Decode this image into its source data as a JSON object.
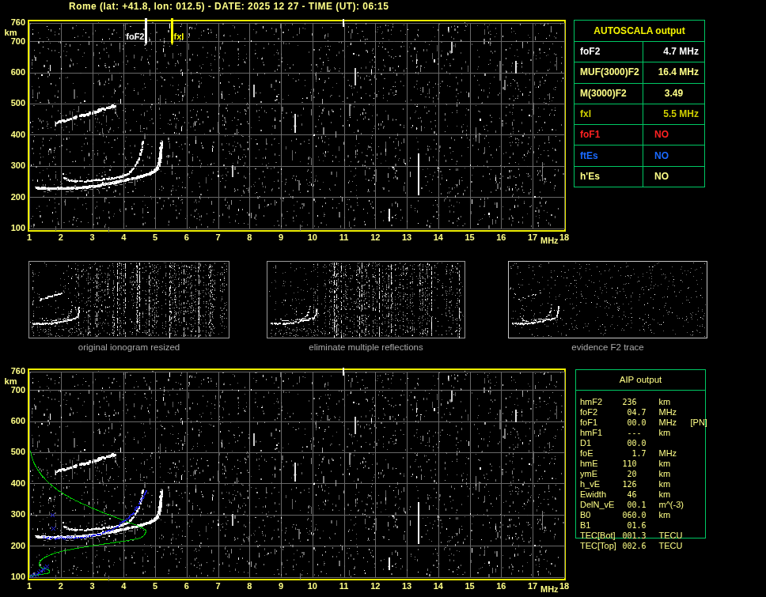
{
  "title": "Rome (lat: +41.8, lon: 012.5) - DATE: 2025 12 27 - TIME (UT): 06:15",
  "colors": {
    "background": "#000000",
    "pale_yellow_text": "#ffff87",
    "bright_yellow": "#f4f400",
    "plot_border_yellow": "#eded00",
    "grid_grey": "#686868",
    "table_border_green": "#00c864",
    "profile_green": "#00cc00",
    "fitted_blue": "#2222ee",
    "foF2_marker_white": "#ffffff",
    "fxI_marker_yellow": "#ffff00",
    "red": "#ff2222",
    "blue_text": "#1a6aff",
    "dark_yellow": "#cfcf00",
    "caption_grey": "#a9a9a9"
  },
  "autoscala_table": {
    "header": "AUTOSCALA output",
    "rows": [
      {
        "param": "foF2",
        "value": "4.7 MHz",
        "color": "#ffffff",
        "align": "right"
      },
      {
        "param": "MUF(3000)F2",
        "value": "16.4 MHz",
        "color": "#ffff87",
        "align": "right"
      },
      {
        "param": "M(3000)F2",
        "value": "3.49",
        "color": "#ffff87",
        "align": "center"
      },
      {
        "param": "fxI",
        "value": "5.5 MHz",
        "color": "#cfcf00",
        "align": "right"
      },
      {
        "param": "foF1",
        "value": "NO",
        "color": "#ff2222",
        "align": "left"
      },
      {
        "param": "ftEs",
        "value": "NO",
        "color": "#1a6aff",
        "align": "left"
      },
      {
        "param": "h'Es",
        "value": "NO",
        "color": "#ffff87",
        "align": "left"
      }
    ]
  },
  "panels": [
    {
      "caption": "original ionogram resized"
    },
    {
      "caption": "eliminate multiple reflections"
    },
    {
      "caption": "evidence F2 trace"
    }
  ],
  "aip_table": {
    "header": "AIP output",
    "rows": [
      {
        "param": "hmF2",
        "value": "236",
        "unit": "km",
        "note": ""
      },
      {
        "param": "foF2",
        "value": " 04.7",
        "unit": "MHz",
        "note": ""
      },
      {
        "param": "foF1",
        "value": " 00.0",
        "unit": "MHz",
        "note": "[PN]"
      },
      {
        "param": "hmF1",
        "value": " ---",
        "unit": "km",
        "note": ""
      },
      {
        "param": "D1",
        "value": " 00.0",
        "unit": "",
        "note": ""
      },
      {
        "param": "foE",
        "value": "  1.7",
        "unit": "MHz",
        "note": ""
      },
      {
        "param": "hmE",
        "value": "110",
        "unit": "km",
        "note": ""
      },
      {
        "param": "ymE",
        "value": " 20",
        "unit": "km",
        "note": ""
      },
      {
        "param": "h_vE",
        "value": "126",
        "unit": "km",
        "note": ""
      },
      {
        "param": "Ewidth",
        "value": " 46",
        "unit": "km",
        "note": ""
      },
      {
        "param": "DelN_vE",
        "value": " 00.1",
        "unit": "m^(-3)",
        "note": ""
      },
      {
        "param": "B0",
        "value": "060.0",
        "unit": "km",
        "note": ""
      },
      {
        "param": "B1",
        "value": " 01.6",
        "unit": "",
        "note": ""
      },
      {
        "param": "TEC[Bot]",
        "value": "001.3",
        "unit": "TECU",
        "note": ""
      },
      {
        "param": "TEC[Top]",
        "value": "002.6",
        "unit": "TECU",
        "note": ""
      }
    ]
  },
  "chart_data": {
    "type": "ionogram",
    "station": "Rome",
    "lat": "+41.8",
    "lon": "012.5",
    "date": "2025 12 27",
    "time_ut": "06:15",
    "x_axis": {
      "unit": "MHz",
      "min": 1,
      "max": 18,
      "ticks": [
        "1",
        "2",
        "3",
        "4",
        "5",
        "6",
        "7",
        "8",
        "9",
        "10",
        "11",
        "12",
        "13",
        "14",
        "15",
        "16",
        "17",
        "18"
      ]
    },
    "y_axis": {
      "unit": "km",
      "min": 100,
      "max": 760,
      "tick_labels": [
        "760",
        "km",
        "700",
        "600",
        "500",
        "400",
        "300",
        "200",
        "100"
      ]
    },
    "scaled_values": {
      "foF2_MHz": 4.7,
      "MUF3000F2_MHz": 16.4,
      "M3000F2": 3.49,
      "fxI_MHz": 5.5,
      "foF1": null,
      "ftEs": null,
      "hEs": null
    },
    "markers": [
      {
        "label": "foF2",
        "MHz": 4.71,
        "color": "#ffffff"
      },
      {
        "label": "fxI",
        "MHz": 5.52,
        "color": "#ffff00"
      }
    ],
    "traces": {
      "o_lower": {
        "th": 3,
        "pts": [
          [
            1.25,
            228
          ],
          [
            1.6,
            227
          ],
          [
            2.0,
            227
          ],
          [
            2.4,
            228
          ],
          [
            2.8,
            231
          ],
          [
            3.2,
            236
          ],
          [
            3.5,
            242
          ],
          [
            3.8,
            248
          ],
          [
            4.1,
            255
          ],
          [
            4.4,
            262
          ],
          [
            4.7,
            270
          ],
          [
            4.9,
            277
          ],
          [
            5.02,
            285
          ],
          [
            5.1,
            296
          ],
          [
            5.15,
            315
          ],
          [
            5.18,
            338
          ],
          [
            5.2,
            358
          ],
          [
            5.21,
            375
          ]
        ]
      },
      "x_upper": {
        "th": 2,
        "pts": [
          [
            2.08,
            271
          ],
          [
            2.13,
            260
          ],
          [
            2.25,
            253
          ],
          [
            2.5,
            250
          ],
          [
            2.8,
            251
          ],
          [
            3.1,
            253
          ],
          [
            3.4,
            256
          ],
          [
            3.7,
            260
          ],
          [
            3.95,
            265
          ],
          [
            4.1,
            271
          ],
          [
            4.22,
            279
          ]
        ]
      },
      "x_hook": {
        "th": 2,
        "pts": [
          [
            4.22,
            280
          ],
          [
            4.32,
            292
          ],
          [
            4.42,
            308
          ],
          [
            4.5,
            326
          ],
          [
            4.56,
            346
          ],
          [
            4.6,
            364
          ],
          [
            4.62,
            380
          ]
        ]
      },
      "hop": {
        "th": 3,
        "pts": [
          [
            1.85,
            437
          ],
          [
            2.1,
            443
          ],
          [
            2.4,
            452
          ],
          [
            2.7,
            461
          ],
          [
            3.0,
            470
          ],
          [
            3.3,
            480
          ],
          [
            3.55,
            487
          ],
          [
            3.74,
            491
          ]
        ]
      }
    },
    "profile_MHz_km": [
      [
        1.02,
        505
      ],
      [
        1.1,
        475
      ],
      [
        1.22,
        450
      ],
      [
        1.38,
        427
      ],
      [
        1.58,
        405
      ],
      [
        1.82,
        385
      ],
      [
        2.1,
        366
      ],
      [
        2.42,
        348
      ],
      [
        2.78,
        331
      ],
      [
        3.15,
        315
      ],
      [
        3.55,
        299
      ],
      [
        3.95,
        284
      ],
      [
        4.3,
        271
      ],
      [
        4.55,
        260
      ],
      [
        4.68,
        252
      ],
      [
        4.71,
        247
      ],
      [
        4.6,
        228
      ],
      [
        4.35,
        222
      ],
      [
        4.0,
        216
      ],
      [
        3.6,
        210
      ],
      [
        3.2,
        204
      ],
      [
        2.8,
        198
      ],
      [
        2.4,
        191
      ],
      [
        2.05,
        184
      ],
      [
        1.78,
        177
      ],
      [
        1.58,
        169
      ],
      [
        1.44,
        161
      ],
      [
        1.35,
        153
      ],
      [
        1.3,
        146
      ],
      [
        1.29,
        140
      ],
      [
        1.32,
        134
      ],
      [
        1.4,
        129
      ],
      [
        1.5,
        128
      ],
      [
        1.6,
        124
      ],
      [
        1.64,
        119
      ],
      [
        1.62,
        114
      ],
      [
        1.5,
        111
      ],
      [
        1.35,
        109
      ],
      [
        1.25,
        107
      ],
      [
        1.1,
        105
      ],
      [
        1.0,
        103
      ]
    ],
    "fitted_trace_MHz_km": [
      [
        1.45,
        227
      ],
      [
        1.8,
        226
      ],
      [
        2.2,
        226
      ],
      [
        2.6,
        228
      ],
      [
        2.95,
        232
      ],
      [
        3.25,
        240
      ],
      [
        3.55,
        252
      ],
      [
        3.85,
        268
      ],
      [
        4.1,
        288
      ],
      [
        4.3,
        310
      ],
      [
        4.45,
        330
      ],
      [
        4.55,
        348
      ],
      [
        4.63,
        362
      ],
      [
        4.69,
        378
      ]
    ],
    "fitted_outliers_MHz_km": [
      [
        1.72,
        300
      ],
      [
        1.76,
        255
      ],
      [
        1.05,
        104
      ],
      [
        1.15,
        106
      ],
      [
        1.22,
        109
      ],
      [
        1.3,
        113
      ],
      [
        1.35,
        118
      ],
      [
        1.42,
        124
      ],
      [
        1.5,
        130
      ],
      [
        1.55,
        135
      ]
    ],
    "noise": {
      "seed": 20251227,
      "dots": 2600,
      "streaks": 40,
      "bright_streaks": [
        {
          "MHz": 10.97,
          "km": [
            772,
            745
          ],
          "color": "#ffffff"
        },
        {
          "MHz": 13.35,
          "km": [
            340,
            205
          ],
          "color": "#ffffff"
        },
        {
          "MHz": 9.42,
          "km": [
            468,
            405
          ],
          "color": "#e8e8e8"
        },
        {
          "MHz": 11.33,
          "km": [
            615,
            558
          ],
          "color": "#d0d0d0"
        },
        {
          "MHz": 16.45,
          "km": [
            638,
            597
          ],
          "color": "#e0e0e0"
        },
        {
          "MHz": 12.42,
          "km": [
            163,
            122
          ],
          "color": "#ffffff"
        },
        {
          "MHz": 7.45,
          "km": [
            303,
            264
          ],
          "color": "#c8c8c8"
        },
        {
          "MHz": 14.42,
          "km": [
            698,
            662
          ],
          "color": "#c8c8c8"
        },
        {
          "MHz": 8.13,
          "km": [
            560,
            520
          ],
          "color": "#cccccc"
        }
      ]
    }
  }
}
